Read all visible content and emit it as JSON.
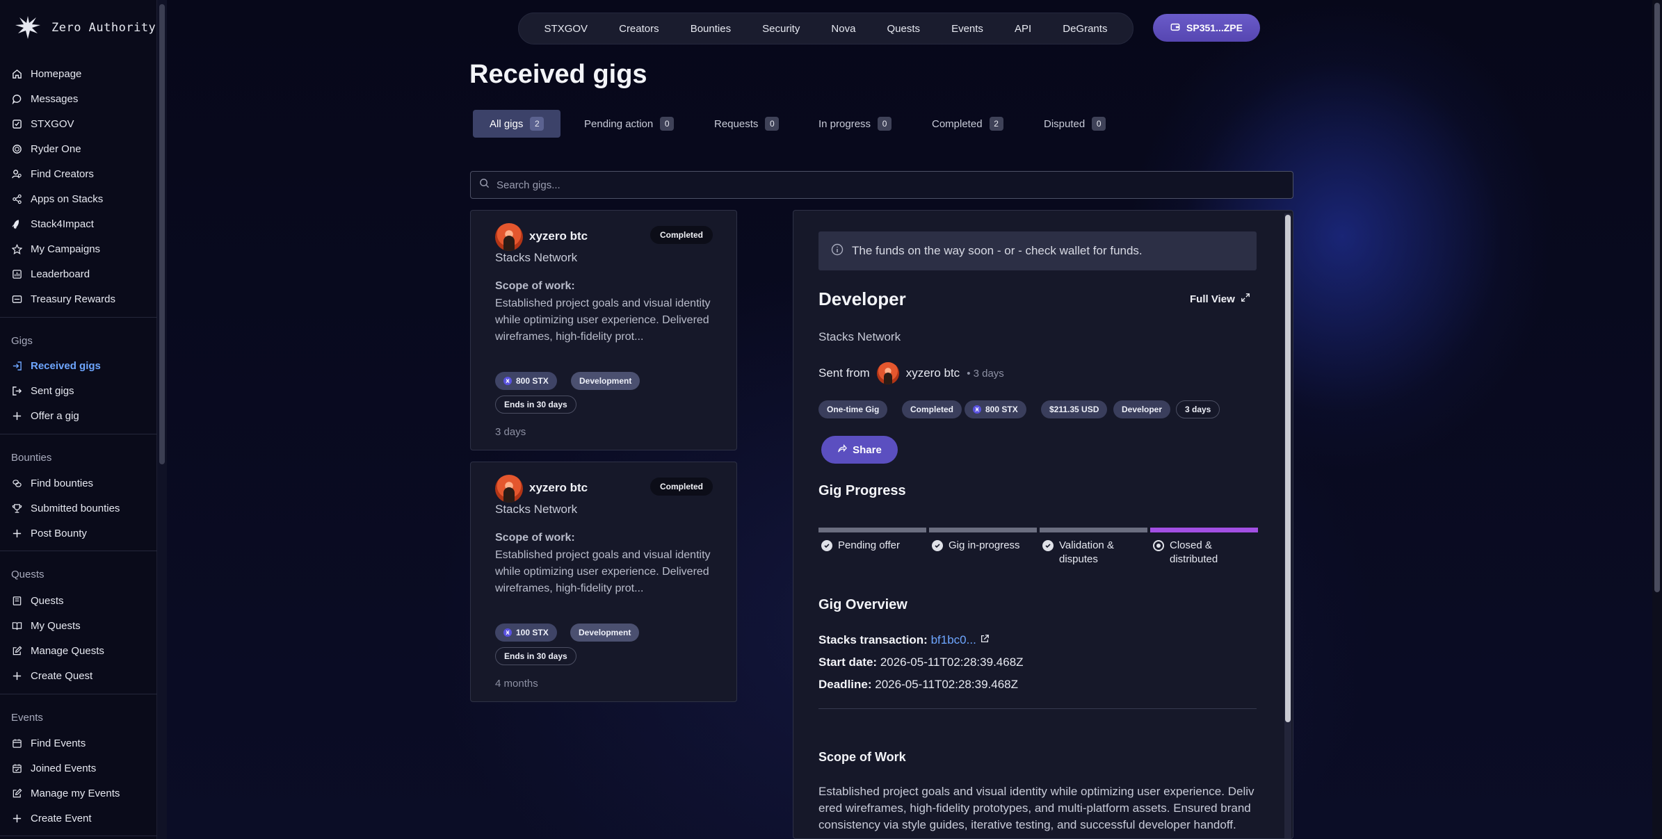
{
  "brand": {
    "name": "Zero Authority"
  },
  "sidebar": {
    "main": [
      {
        "label": "Homepage",
        "icon": "home-icon"
      },
      {
        "label": "Messages",
        "icon": "chat-icon"
      },
      {
        "label": "STXGOV",
        "icon": "checkbox-icon"
      },
      {
        "label": "Ryder One",
        "icon": "ring-icon"
      },
      {
        "label": "Find Creators",
        "icon": "user-search-icon"
      },
      {
        "label": "Apps on Stacks",
        "icon": "share-nodes-icon"
      },
      {
        "label": "Stack4Impact",
        "icon": "rocket-icon"
      },
      {
        "label": "My Campaigns",
        "icon": "star-icon"
      },
      {
        "label": "Leaderboard",
        "icon": "chart-icon"
      },
      {
        "label": "Treasury Rewards",
        "icon": "wallet-icon"
      }
    ],
    "gigs_title": "Gigs",
    "gigs": [
      {
        "label": "Received gigs",
        "icon": "sign-in-icon"
      },
      {
        "label": "Sent gigs",
        "icon": "send-icon"
      },
      {
        "label": "Offer a gig",
        "icon": "plus-icon"
      }
    ],
    "bounties_title": "Bounties",
    "bounties": [
      {
        "label": "Find bounties",
        "icon": "coins-icon"
      },
      {
        "label": "Submitted bounties",
        "icon": "trophy-icon"
      },
      {
        "label": "Post Bounty",
        "icon": "plus-icon"
      }
    ],
    "quests_title": "Quests",
    "quests": [
      {
        "label": "Quests",
        "icon": "book-icon"
      },
      {
        "label": "My Quests",
        "icon": "book-open-icon"
      },
      {
        "label": "Manage Quests",
        "icon": "edit-icon"
      },
      {
        "label": "Create Quest",
        "icon": "plus-icon"
      }
    ],
    "events_title": "Events",
    "events": [
      {
        "label": "Find Events",
        "icon": "calendar-icon"
      },
      {
        "label": "Joined Events",
        "icon": "calendar-check-icon"
      },
      {
        "label": "Manage my Events",
        "icon": "edit-icon"
      },
      {
        "label": "Create Event",
        "icon": "plus-icon"
      }
    ]
  },
  "topnav": [
    "STXGOV",
    "Creators",
    "Bounties",
    "Security",
    "Nova",
    "Quests",
    "Events",
    "API",
    "DeGrants"
  ],
  "wallet": {
    "label": "SP351...ZPE"
  },
  "page": {
    "title": "Received gigs"
  },
  "tabs": [
    {
      "label": "All gigs",
      "count": "2"
    },
    {
      "label": "Pending action",
      "count": "0"
    },
    {
      "label": "Requests",
      "count": "0"
    },
    {
      "label": "In progress",
      "count": "0"
    },
    {
      "label": "Completed",
      "count": "2"
    },
    {
      "label": "Disputed",
      "count": "0"
    }
  ],
  "search": {
    "placeholder": "Search gigs..."
  },
  "gigs": [
    {
      "name": "xyzero btc",
      "status": "Completed",
      "org": "Stacks Network",
      "scope_label": "Scope of work:",
      "scope": "Established project goals and visual identity while optimizing user experience. Delivered wireframes, high-fidelity prot...",
      "amount": "800 STX",
      "category": "Development",
      "ends": "Ends in 30 days",
      "age": "3 days"
    },
    {
      "name": "xyzero btc",
      "status": "Completed",
      "org": "Stacks Network",
      "scope_label": "Scope of work:",
      "scope": "Established project goals and visual identity while optimizing user experience. Delivered wireframes, high-fidelity prot...",
      "amount": "100 STX",
      "category": "Development",
      "ends": "Ends in 30 days",
      "age": "4 months"
    }
  ],
  "detail": {
    "notice": "The funds on the way soon - or - check wallet for funds.",
    "title": "Developer",
    "full_view": "Full View",
    "org": "Stacks Network",
    "sent_from_label": "Sent from",
    "sender": "xyzero btc",
    "sent_ago": "• 3 days",
    "tags": {
      "type": "One-time Gig",
      "status": "Completed",
      "amount": "800 STX",
      "usd": "$211.35 USD",
      "role": "Developer",
      "duration": "3 days"
    },
    "share": "Share",
    "progress_title": "Gig Progress",
    "progress": [
      {
        "label": "Pending offer",
        "color": "#6b6e80"
      },
      {
        "label": "Gig in-progress",
        "color": "#6b6e80"
      },
      {
        "label": "Validation & disputes",
        "color": "#6b6e80"
      },
      {
        "label": "Closed & distributed",
        "color": "#a24fe3"
      }
    ],
    "overview_title": "Gig Overview",
    "tx_label": "Stacks transaction:",
    "tx_value": "bf1bc0...",
    "start_label": "Start date:",
    "start_value": "2026-05-11T02:28:39.468Z",
    "deadline_label": "Deadline:",
    "deadline_value": "2026-05-11T02:28:39.468Z",
    "scope_title": "Scope of Work",
    "scope_text": "Established project goals and visual identity while optimizing user experience. Delivered wireframes, high-fidelity prototypes, and multi-platform assets. Ensured brand consistency via style guides, iterative testing, and successful developer handoff."
  }
}
